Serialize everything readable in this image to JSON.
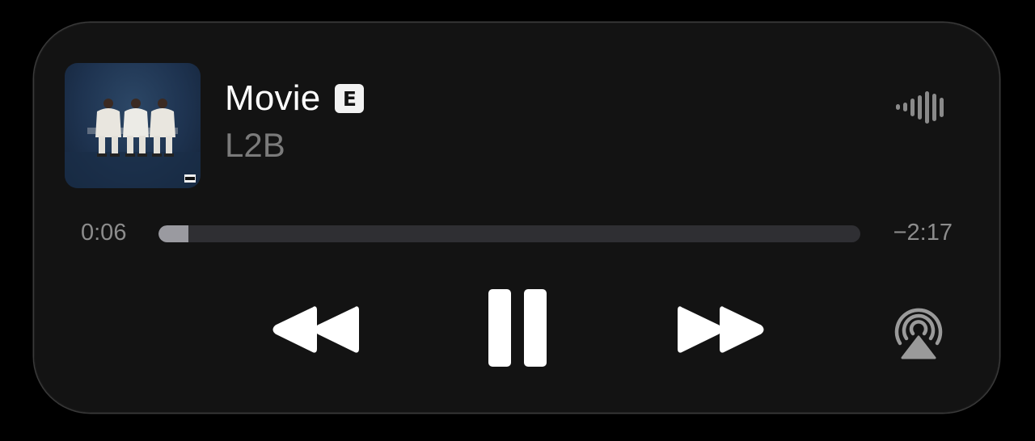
{
  "now_playing": {
    "title": "Movie",
    "explicit_badge": "E",
    "artist": "L2B",
    "artwork_icon": "album-artwork"
  },
  "playback": {
    "elapsed": "0:06",
    "remaining": "−2:17",
    "progress_fraction": 0.043,
    "state": "playing"
  },
  "controls": {
    "rewind_icon": "rewind-icon",
    "pause_icon": "pause-icon",
    "forward_icon": "fast-forward-icon",
    "airplay_icon": "airplay-audio-icon",
    "waveform_icon": "audio-waveform-icon"
  },
  "colors": {
    "background": "#000000",
    "panel": "#131313",
    "title": "#ffffff",
    "artist": "#7b7b7b",
    "track": "#2f2f33",
    "fill": "#9a9aa0"
  }
}
